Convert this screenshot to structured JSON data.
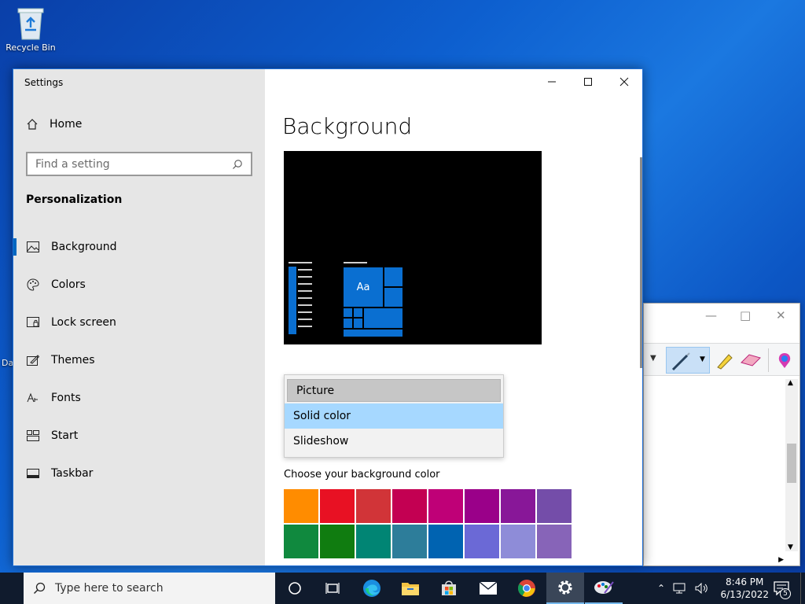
{
  "desktop": {
    "recycle_bin_label": "Recycle Bin",
    "edge_clip_label": "Da"
  },
  "settings": {
    "window_title": "Settings",
    "home_label": "Home",
    "search_placeholder": "Find a setting",
    "section_title": "Personalization",
    "nav_items": [
      {
        "label": "Background",
        "icon": "picture-icon",
        "active": true
      },
      {
        "label": "Colors",
        "icon": "palette-icon"
      },
      {
        "label": "Lock screen",
        "icon": "lock-screen-icon"
      },
      {
        "label": "Themes",
        "icon": "themes-icon"
      },
      {
        "label": "Fonts",
        "icon": "fonts-icon"
      },
      {
        "label": "Start",
        "icon": "start-icon"
      },
      {
        "label": "Taskbar",
        "icon": "taskbar-icon"
      }
    ],
    "page_title": "Background",
    "preview_tile_text": "Aa",
    "background_options": [
      "Picture",
      "Solid color",
      "Slideshow"
    ],
    "selected_option": "Solid color",
    "choose_color_label": "Choose your background color",
    "color_swatches": [
      "#ff8c00",
      "#e81123",
      "#d13438",
      "#c30052",
      "#bf0077",
      "#9a0089",
      "#881798",
      "#744da9",
      "#10893e",
      "#107c10",
      "#018574",
      "#2d7d9a",
      "#0063b1",
      "#6b69d6",
      "#8e8cd8",
      "#8764b8"
    ]
  },
  "taskbar": {
    "search_placeholder": "Type here to search",
    "time": "8:46 PM",
    "date": "6/13/2022",
    "notification_count": "5"
  }
}
